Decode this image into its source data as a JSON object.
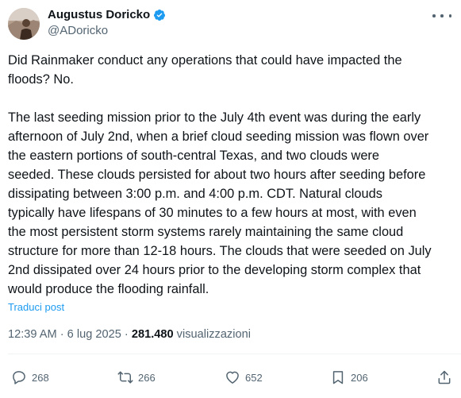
{
  "author": {
    "display_name": "Augustus Doricko",
    "handle": "@ADoricko",
    "verified_color": "#1d9bf0"
  },
  "tweet": {
    "paragraphs": [
      "Did Rainmaker conduct any operations that could have impacted the\nfloods? No.",
      "The last seeding mission prior to the July 4th event was during the early\nafternoon of July 2nd, when a brief cloud seeding mission was flown over\nthe eastern portions of south-central Texas, and two clouds were\nseeded. These clouds persisted for about two hours after seeding before\ndissipating between 3:00 p.m. and 4:00 p.m. CDT. Natural clouds\ntypically have lifespans of 30 minutes to a few hours at most, with even\nthe most persistent storm systems rarely maintaining the same cloud\nstructure for more than 12-18 hours. The clouds that were seeded on July\n2nd dissipated over 24 hours prior to the developing storm complex that\nwould produce the flooding rainfall."
    ],
    "translate_label": "Traduci post"
  },
  "meta": {
    "time": "12:39 AM",
    "separator": "·",
    "date": "6 lug 2025",
    "views_count": "281.480",
    "views_label": "visualizzazioni"
  },
  "actions": {
    "replies": "268",
    "reposts": "266",
    "likes": "652",
    "bookmarks": "206"
  },
  "icons": [
    "more-options-icon",
    "verified-badge-icon",
    "reply-icon",
    "repost-icon",
    "like-icon",
    "bookmark-icon",
    "share-icon"
  ]
}
